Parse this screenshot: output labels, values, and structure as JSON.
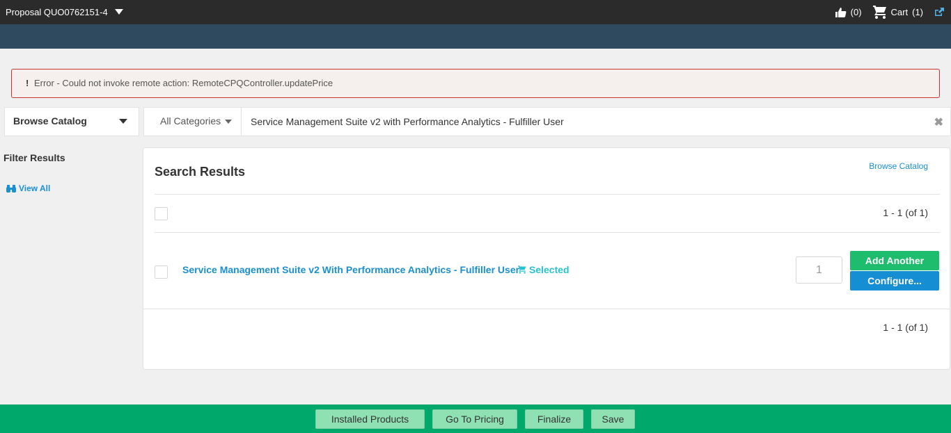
{
  "header": {
    "title": "Proposal QUO0762151-4",
    "likes_count": "(0)",
    "cart_label": "Cart",
    "cart_count": "(1)"
  },
  "error": {
    "bang": "!",
    "message": "Error - Could not invoke remote action: RemoteCPQController.updatePrice"
  },
  "toolbar": {
    "browse_dropdown": "Browse Catalog",
    "category_dropdown": "All Categories",
    "search_value": "Service Management Suite v2 with Performance Analytics - Fulfiller User"
  },
  "sidebar": {
    "filter_title": "Filter Results",
    "view_all": "View All"
  },
  "results": {
    "heading": "Search Results",
    "browse_link": "Browse Catalog",
    "pager_top": "1 - 1 (of 1)",
    "pager_bottom": "1 - 1 (of 1)",
    "items": [
      {
        "name": "Service Management Suite v2 With Performance Analytics - Fulfiller User",
        "status": "Selected",
        "quantity": "1",
        "add_label": "Add Another",
        "configure_label": "Configure..."
      }
    ]
  },
  "footer": {
    "installed": "Installed Products",
    "pricing": "Go To Pricing",
    "finalize": "Finalize",
    "save": "Save"
  },
  "colors": {
    "topbar": "#2b2b2b",
    "subbar": "#2f4a5f",
    "link": "#1a8fd1",
    "selected": "#29c2d0",
    "add_button": "#1ebc6d",
    "configure_button": "#168ed4",
    "footer": "#00a86b",
    "footer_button": "#8fe0b3",
    "error_border": "#c9302c"
  },
  "icons": [
    "caret-down-icon",
    "thumbs-up-icon",
    "cart-icon",
    "external-link-icon",
    "binoculars-icon",
    "close-icon"
  ]
}
